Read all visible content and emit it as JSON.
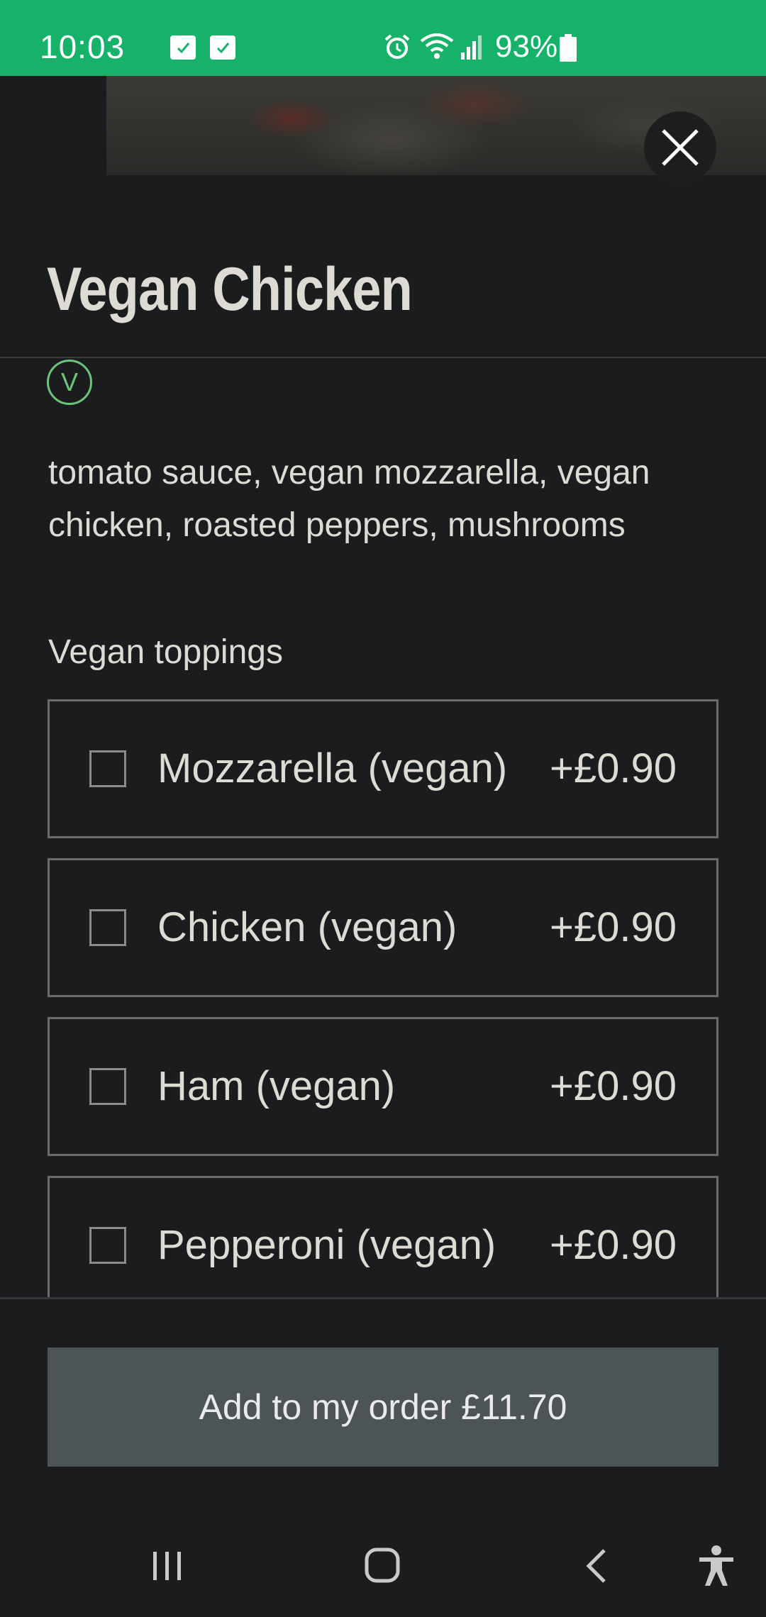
{
  "status_bar": {
    "time": "10:03",
    "battery": "93%",
    "icons": [
      "check-notification-icon",
      "check-notification-icon",
      "alarm-icon",
      "wifi-icon",
      "signal-icon",
      "battery-icon"
    ]
  },
  "product": {
    "title": "Vegan Chicken",
    "badge_letter": "V",
    "description": "tomato sauce, vegan mozzarella, vegan chicken, roasted peppers, mushrooms"
  },
  "toppings": {
    "label": "Vegan toppings",
    "items": [
      {
        "name": "Mozzarella (vegan)",
        "price": "+£0.90",
        "checked": false
      },
      {
        "name": "Chicken (vegan)",
        "price": "+£0.90",
        "checked": false
      },
      {
        "name": "Ham (vegan)",
        "price": "+£0.90",
        "checked": false
      },
      {
        "name": "Pepperoni (vegan)",
        "price": "+£0.90",
        "checked": false
      }
    ]
  },
  "order": {
    "button_label": "Add to my order £11.70"
  },
  "nav": {
    "items": [
      "recent-apps-icon",
      "home-icon",
      "back-icon",
      "accessibility-icon"
    ]
  },
  "colors": {
    "status_bar": "#17b26a",
    "background": "#1b1c1e",
    "vegan_badge": "#6cc47a",
    "button": "#4d5458"
  }
}
